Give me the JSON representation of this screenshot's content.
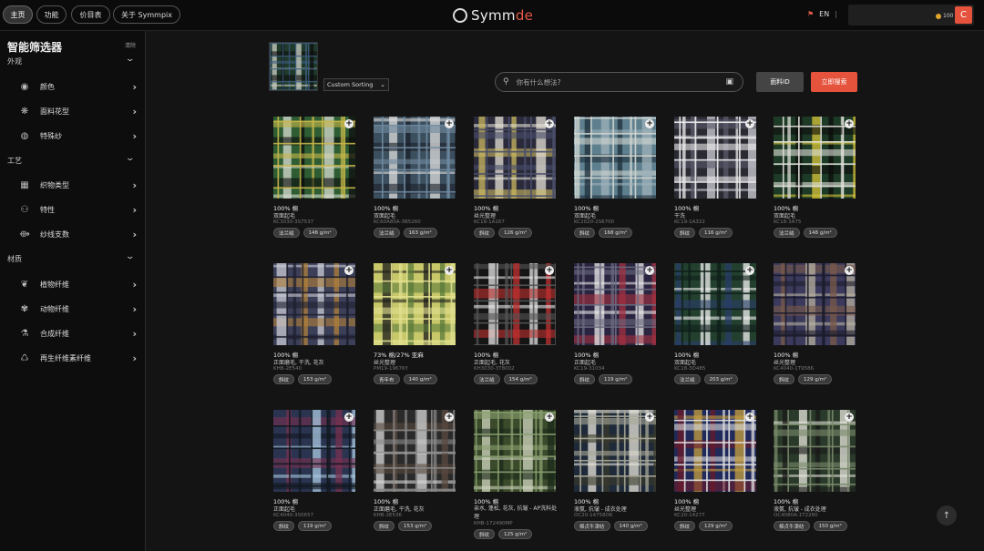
{
  "nav": {
    "home": "主页",
    "features": "功能",
    "pricing": "价目表",
    "about": "关于 Symmpix"
  },
  "logo": {
    "prefix": "Symm",
    "suffix": "de"
  },
  "lang": {
    "code": "EN"
  },
  "user": {
    "coins": "100",
    "avatar": "C"
  },
  "sidebar": {
    "title": "智能筛选器",
    "reset": "清除",
    "sections": [
      {
        "label": "外观",
        "items": [
          {
            "label": "颜色",
            "icon": "palette-icon"
          },
          {
            "label": "面料花型",
            "icon": "pattern-icon"
          },
          {
            "label": "特殊纱",
            "icon": "yarn-icon"
          }
        ]
      },
      {
        "label": "工艺",
        "items": [
          {
            "label": "织物类型",
            "icon": "weave-icon"
          },
          {
            "label": "特性",
            "icon": "feature-icon"
          },
          {
            "label": "纱线支数",
            "icon": "thread-count-icon"
          }
        ]
      },
      {
        "label": "材质",
        "items": [
          {
            "label": "植物纤维",
            "icon": "plant-icon"
          },
          {
            "label": "动物纤维",
            "icon": "paw-icon"
          },
          {
            "label": "合成纤维",
            "icon": "flask-icon"
          },
          {
            "label": "再生纤维素纤维",
            "icon": "recycle-icon"
          }
        ]
      }
    ]
  },
  "toolbar": {
    "sort": "Custom Sorting",
    "search_placeholder": "你有什么想法?",
    "id_button": "面料ID",
    "search_button": "立即搜索"
  },
  "cards": [
    {
      "comp": "100% 棉",
      "finish": "双面起毛",
      "code": "KC3030-3S7537",
      "tags": [
        "法兰绒",
        "148 g/m²"
      ],
      "colors": [
        "#2e5d34",
        "#d9dcd2",
        "#0c0c0c",
        "#c7b74a"
      ]
    },
    {
      "comp": "100% 棉",
      "finish": "双面起毛",
      "code": "KC60A80A-3B5260",
      "tags": [
        "法兰绒",
        "163 g/m²"
      ],
      "colors": [
        "#3c4f5e",
        "#dcdcdc",
        "#1a1f2a",
        "#6f8aa0"
      ]
    },
    {
      "comp": "100% 棉",
      "finish": "丝光整理",
      "code": "KC18-1A167",
      "tags": [
        "斜纹",
        "126 g/m²"
      ],
      "colors": [
        "#2a2a3a",
        "#e5e2d5",
        "#c9b860",
        "#4a4f6a"
      ]
    },
    {
      "comp": "100% 棉",
      "finish": "双面起毛",
      "code": "KC2020-2S6700",
      "tags": [
        "斜纹",
        "168 g/m²"
      ],
      "colors": [
        "#5e7f8e",
        "#9fb2ba",
        "#1e2e3a",
        "#d0d5d0"
      ]
    },
    {
      "comp": "100% 棉",
      "finish": "干洗",
      "code": "KC19-1A322",
      "tags": [
        "斜纹",
        "116 g/m²"
      ],
      "colors": [
        "#2a2a33",
        "#cfcfd6",
        "#5a5a6a",
        "#eeeeee"
      ]
    },
    {
      "comp": "100% 棉",
      "finish": "双面起毛",
      "code": "KC18-3A75",
      "tags": [
        "法兰绒",
        "148 g/m²"
      ],
      "colors": [
        "#1c3a26",
        "#d8c63a",
        "#0c0c0c",
        "#e0e0d8"
      ]
    },
    {
      "comp": "100% 棉",
      "finish": "正面磨毛, 干洗, 花灰",
      "code": "KHB-2E540",
      "tags": [
        "斜纹",
        "153 g/m²"
      ],
      "colors": [
        "#3c3f58",
        "#c9ccd6",
        "#b0803a",
        "#1e2030"
      ]
    },
    {
      "comp": "73% 棉/27% 亚麻",
      "finish": "丝光整理",
      "code": "PM19-19676Y",
      "tags": [
        "青年布",
        "140 g/m²"
      ],
      "colors": [
        "#c8c86a",
        "#1a1a1a",
        "#5a7a3a",
        "#e0e090"
      ]
    },
    {
      "comp": "100% 棉",
      "finish": "正面起毛, 花灰",
      "code": "KH3030-3T8002",
      "tags": [
        "法兰绒",
        "154 g/m²"
      ],
      "colors": [
        "#151515",
        "#e6e6e6",
        "#c23030",
        "#555555"
      ]
    },
    {
      "comp": "100% 棉",
      "finish": "正面起毛",
      "code": "KC19-31034",
      "tags": [
        "斜纹",
        "119 g/m²"
      ],
      "colors": [
        "#2a2440",
        "#eaeaea",
        "#a33040",
        "#6a6a80"
      ]
    },
    {
      "comp": "100% 棉",
      "finish": "双面起毛",
      "code": "KC18-3D485",
      "tags": [
        "法兰绒",
        "203 g/m²"
      ],
      "colors": [
        "#23402e",
        "#f0f0f0",
        "#2a3e6a",
        "#0f1f1a"
      ]
    },
    {
      "comp": "100% 棉",
      "finish": "丝光整理",
      "code": "KC4040-1T9586",
      "tags": [
        "斜纹",
        "129 g/m²"
      ],
      "colors": [
        "#3b3a5c",
        "#b8b0a0",
        "#7a5a4a",
        "#1c1c2c"
      ]
    },
    {
      "comp": "100% 棉",
      "finish": "正面起毛",
      "code": "KC4040-3S5657",
      "tags": [
        "斜纹",
        "119 g/m²"
      ],
      "colors": [
        "#2a3450",
        "#a9c8e0",
        "#7a3050",
        "#111820"
      ]
    },
    {
      "comp": "100% 棉",
      "finish": "正面磨毛, 干洗, 花灰",
      "code": "KHB-2E536",
      "tags": [
        "斜纹",
        "153 g/m²"
      ],
      "colors": [
        "#2a2a2a",
        "#d8d8d8",
        "#5a4a40",
        "#8a8a8a"
      ]
    },
    {
      "comp": "100% 棉",
      "finish": "亲水, 蓬松, 花灰, 抗皱 - AP洗料处理",
      "code": "KHB-172490MP",
      "tags": [
        "斜纹",
        "125 g/m²"
      ],
      "colors": [
        "#3a4a2a",
        "#d0d6c0",
        "#1a2a1a",
        "#8aa070"
      ]
    },
    {
      "comp": "100% 棉",
      "finish": "液氨, 抗皱 - 成衣处理",
      "code": "OC20-14758OK",
      "tags": [
        "棉贞牛津纺",
        "140 g/m²"
      ],
      "colors": [
        "#1e2a3a",
        "#e8e6da",
        "#3a3a2a",
        "#a8a898"
      ]
    },
    {
      "comp": "100% 棉",
      "finish": "丝光整理",
      "code": "KC20-14277",
      "tags": [
        "斜纹",
        "129 g/m²"
      ],
      "colors": [
        "#1f2a5a",
        "#c8a040",
        "#6a1a2a",
        "#e0e0e0"
      ]
    },
    {
      "comp": "100% 棉",
      "finish": "液氨, 抗皱 - 成衣处理",
      "code": "OC4080A-1T2280",
      "tags": [
        "棉贞牛津纺",
        "150 g/m²"
      ],
      "colors": [
        "#2a3a2a",
        "#e6e6dc",
        "#1a1a1a",
        "#7a8a6a"
      ]
    }
  ],
  "thumb_colors": [
    "#1f3a2a",
    "#cfd2c5",
    "#0e0e0e",
    "#3c5c80"
  ]
}
